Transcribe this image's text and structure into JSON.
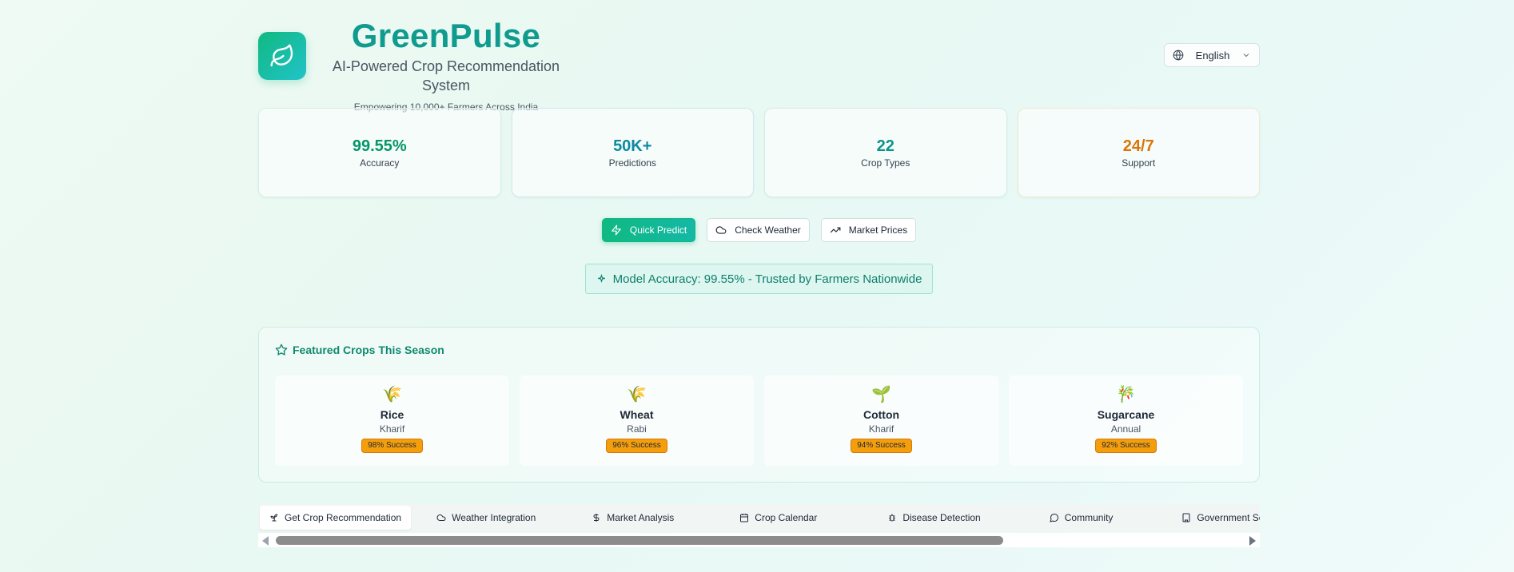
{
  "header": {
    "title": "GreenPulse",
    "tagline": "AI-Powered Crop Recommendation System",
    "subtitle": "Empowering 10,000+ Farmers Across India",
    "language": "English"
  },
  "stats": [
    {
      "value": "99.55%",
      "label": "Accuracy",
      "color": "#059669"
    },
    {
      "value": "50K+",
      "label": "Predictions",
      "color": "#0e8aa0"
    },
    {
      "value": "22",
      "label": "Crop Types",
      "color": "#0d9488"
    },
    {
      "value": "24/7",
      "label": "Support",
      "color": "#d97706"
    }
  ],
  "actions": {
    "quick_predict": "Quick Predict",
    "check_weather": "Check Weather",
    "market_prices": "Market Prices"
  },
  "accuracy_banner": "Model Accuracy: 99.55% - Trusted by Farmers Nationwide",
  "featured": {
    "title": "Featured Crops This Season",
    "crops": [
      {
        "emoji": "🌾",
        "name": "Rice",
        "season": "Kharif",
        "badge": "98% Success"
      },
      {
        "emoji": "🌾",
        "name": "Wheat",
        "season": "Rabi",
        "badge": "96% Success"
      },
      {
        "emoji": "🌱",
        "name": "Cotton",
        "season": "Kharif",
        "badge": "94% Success"
      },
      {
        "emoji": "🎋",
        "name": "Sugarcane",
        "season": "Annual",
        "badge": "92% Success"
      }
    ]
  },
  "tabs": [
    {
      "label": "Get Crop Recommendation",
      "icon": "sprout-icon",
      "active": true
    },
    {
      "label": "Weather Integration",
      "icon": "cloud-icon"
    },
    {
      "label": "Market Analysis",
      "icon": "dollar-icon"
    },
    {
      "label": "Crop Calendar",
      "icon": "calendar-icon"
    },
    {
      "label": "Disease Detection",
      "icon": "bug-icon"
    },
    {
      "label": "Community",
      "icon": "chat-icon"
    },
    {
      "label": "Government Schem",
      "icon": "building-icon"
    }
  ]
}
